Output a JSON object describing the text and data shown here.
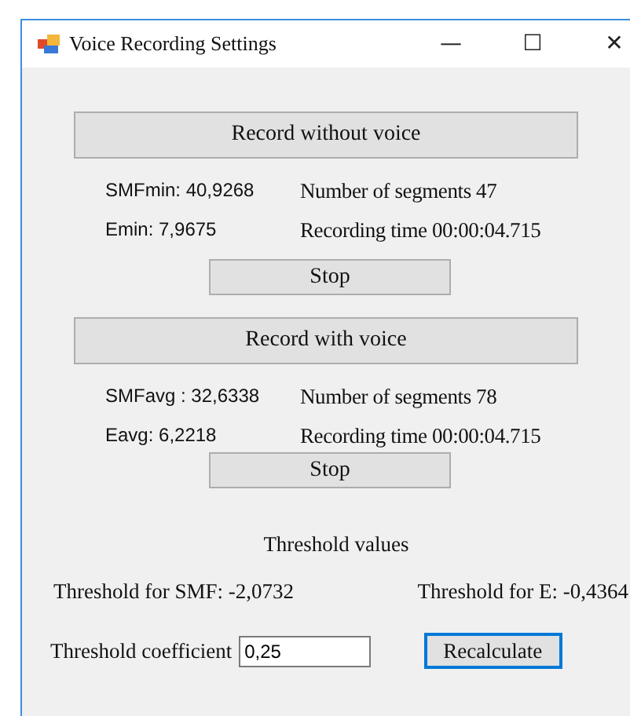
{
  "window": {
    "title": "Voice Recording Settings",
    "controls": [
      "—",
      "☐",
      "✕"
    ]
  },
  "sections": [
    {
      "record_button": "Record without voice",
      "stats": [
        "SMFmin: 40,9268",
        "Emin: 7,9675"
      ],
      "segments": "Number of segments 47",
      "recording_time": "Recording time 00:00:04.715",
      "stop_button": "Stop"
    },
    {
      "record_button": "Record with voice",
      "stats": [
        "SMFavg : 32,6338",
        "Eavg: 6,2218"
      ],
      "segments": "Number of segments 78",
      "recording_time": "Recording time 00:00:04.715",
      "stop_button": "Stop"
    }
  ],
  "threshold": {
    "heading": "Threshold values",
    "smf": "Threshold for SMF: -2,0732",
    "e": "Threshold for E: -0,4364"
  },
  "coefficient": {
    "label": "Threshold coefficient",
    "value": "0,25"
  },
  "recalculate_button": {
    "label": "Recalculate",
    "focused": true
  }
}
